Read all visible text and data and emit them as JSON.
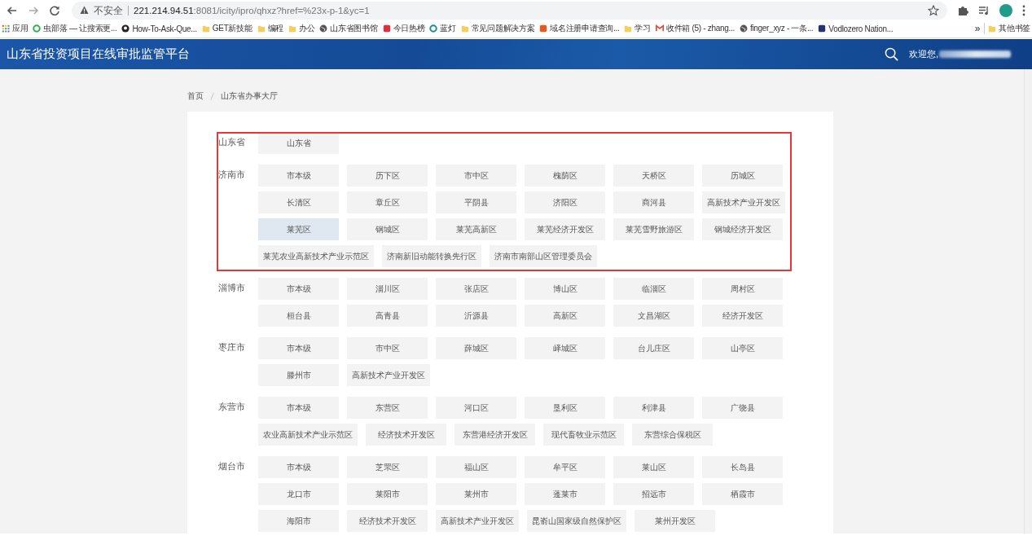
{
  "browser": {
    "security_label": "不安全",
    "url_host": "221.214.94.51",
    "url_path": ":8081/icity/ipro/qhxz?href=%23x-p-1&yc=1",
    "bookmarks": [
      {
        "label": "应用",
        "kind": "grid"
      },
      {
        "label": "虫部落 — 让搜索更...",
        "kind": "ring",
        "color": "#27b34a"
      },
      {
        "label": "How-To-Ask-Que...",
        "kind": "github"
      },
      {
        "label": "GET新技能",
        "kind": "folder"
      },
      {
        "label": "编程",
        "kind": "folder"
      },
      {
        "label": "办公",
        "kind": "folder"
      },
      {
        "label": "山东省图书馆",
        "kind": "globe"
      },
      {
        "label": "今日热榜",
        "kind": "square",
        "color": "#e0303c"
      },
      {
        "label": "蓝灯",
        "kind": "ring",
        "color": "#1a8f8f"
      },
      {
        "label": "常见问题解决方案",
        "kind": "folder"
      },
      {
        "label": "域名注册申请查询...",
        "kind": "square",
        "color": "#e8581c"
      },
      {
        "label": "学习",
        "kind": "folder"
      },
      {
        "label": "收件箱 (5) - zhang...",
        "kind": "mail"
      },
      {
        "label": "finger_xyz - 一条...",
        "kind": "globe"
      },
      {
        "label": "Vodlozero Nation...",
        "kind": "square",
        "color": "#24346e"
      }
    ],
    "overflow": "»",
    "other_bookmarks": "其他书签"
  },
  "header": {
    "title": "山东省投资项目在线审批监管平台",
    "welcome": "欢迎您,"
  },
  "breadcrumb": [
    "首页",
    "山东省办事大厅"
  ],
  "annotation": {
    "kind": "rectangle",
    "color": "#e53935"
  },
  "regions": [
    {
      "name": "山东省",
      "districts": [
        {
          "label": "山东省",
          "selected": false
        }
      ]
    },
    {
      "name": "济南市",
      "districts": [
        {
          "label": "市本级",
          "selected": false
        },
        {
          "label": "历下区",
          "selected": false
        },
        {
          "label": "市中区",
          "selected": false
        },
        {
          "label": "槐荫区",
          "selected": false
        },
        {
          "label": "天桥区",
          "selected": false
        },
        {
          "label": "历城区",
          "selected": false
        },
        {
          "label": "长清区",
          "selected": false
        },
        {
          "label": "章丘区",
          "selected": false
        },
        {
          "label": "平阴县",
          "selected": false
        },
        {
          "label": "济阳区",
          "selected": false
        },
        {
          "label": "商河县",
          "selected": false
        },
        {
          "label": "高新技术产业开发区",
          "selected": false
        },
        {
          "label": "莱芜区",
          "selected": true
        },
        {
          "label": "钢城区",
          "selected": false
        },
        {
          "label": "莱芜高新区",
          "selected": false
        },
        {
          "label": "莱芜经济开发区",
          "selected": false
        },
        {
          "label": "莱芜雪野旅游区",
          "selected": false
        },
        {
          "label": "钢城经济开发区",
          "selected": false
        },
        {
          "label": "莱芜农业高新技术产业示范区",
          "selected": false
        },
        {
          "label": "济南新旧动能转换先行区",
          "selected": false
        },
        {
          "label": "济南市南部山区管理委员会",
          "selected": false
        }
      ]
    },
    {
      "name": "淄博市",
      "districts": [
        {
          "label": "市本级",
          "selected": false
        },
        {
          "label": "淄川区",
          "selected": false
        },
        {
          "label": "张店区",
          "selected": false
        },
        {
          "label": "博山区",
          "selected": false
        },
        {
          "label": "临淄区",
          "selected": false
        },
        {
          "label": "周村区",
          "selected": false
        },
        {
          "label": "桓台县",
          "selected": false
        },
        {
          "label": "高青县",
          "selected": false
        },
        {
          "label": "沂源县",
          "selected": false
        },
        {
          "label": "高新区",
          "selected": false
        },
        {
          "label": "文昌湖区",
          "selected": false
        },
        {
          "label": "经济开发区",
          "selected": false
        }
      ]
    },
    {
      "name": "枣庄市",
      "districts": [
        {
          "label": "市本级",
          "selected": false
        },
        {
          "label": "市中区",
          "selected": false
        },
        {
          "label": "薛城区",
          "selected": false
        },
        {
          "label": "峄城区",
          "selected": false
        },
        {
          "label": "台儿庄区",
          "selected": false
        },
        {
          "label": "山亭区",
          "selected": false
        },
        {
          "label": "滕州市",
          "selected": false
        },
        {
          "label": "高新技术产业开发区",
          "selected": false
        }
      ]
    },
    {
      "name": "东营市",
      "districts": [
        {
          "label": "市本级",
          "selected": false
        },
        {
          "label": "东营区",
          "selected": false
        },
        {
          "label": "河口区",
          "selected": false
        },
        {
          "label": "垦利区",
          "selected": false
        },
        {
          "label": "利津县",
          "selected": false
        },
        {
          "label": "广饶县",
          "selected": false
        },
        {
          "label": "农业高新技术产业示范区",
          "selected": false
        },
        {
          "label": "经济技术开发区",
          "selected": false
        },
        {
          "label": "东营港经济开发区",
          "selected": false
        },
        {
          "label": "现代畜牧业示范区",
          "selected": false
        },
        {
          "label": "东营综合保税区",
          "selected": false
        }
      ]
    },
    {
      "name": "烟台市",
      "districts": [
        {
          "label": "市本级",
          "selected": false
        },
        {
          "label": "芝罘区",
          "selected": false
        },
        {
          "label": "福山区",
          "selected": false
        },
        {
          "label": "牟平区",
          "selected": false
        },
        {
          "label": "莱山区",
          "selected": false
        },
        {
          "label": "长岛县",
          "selected": false
        },
        {
          "label": "龙口市",
          "selected": false
        },
        {
          "label": "莱阳市",
          "selected": false
        },
        {
          "label": "莱州市",
          "selected": false
        },
        {
          "label": "蓬莱市",
          "selected": false
        },
        {
          "label": "招远市",
          "selected": false
        },
        {
          "label": "栖霞市",
          "selected": false
        },
        {
          "label": "海阳市",
          "selected": false
        },
        {
          "label": "经济技术开发区",
          "selected": false
        },
        {
          "label": "高新技术产业开发区",
          "selected": false
        },
        {
          "label": "昆嵛山国家级自然保护区",
          "selected": false
        },
        {
          "label": "莱州开发区",
          "selected": false
        }
      ]
    }
  ]
}
